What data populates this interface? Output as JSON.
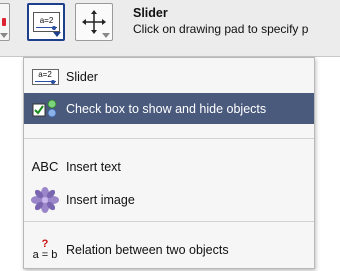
{
  "toolbar": {
    "active_tool_icon_text": "a=2",
    "tool_title": "Slider",
    "tool_description": "Click on drawing pad to specify p"
  },
  "menu": {
    "items": [
      {
        "label": "Slider",
        "icon": "slider-icon",
        "icon_text": "a=2"
      },
      {
        "label": "Check box to show and hide objects",
        "icon": "checkbox-icon",
        "highlighted": true
      },
      {
        "label": "Insert text",
        "icon": "text-icon",
        "icon_text": "ABC"
      },
      {
        "label": "Insert image",
        "icon": "image-icon"
      },
      {
        "label": "Relation between two objects",
        "icon": "relation-icon",
        "icon_text_top": "?",
        "icon_text_bottom": "a = b"
      }
    ]
  },
  "colors": {
    "highlight": "#4a5a7d",
    "selected_border": "#1d3f8c",
    "question_mark": "#cc1111"
  }
}
